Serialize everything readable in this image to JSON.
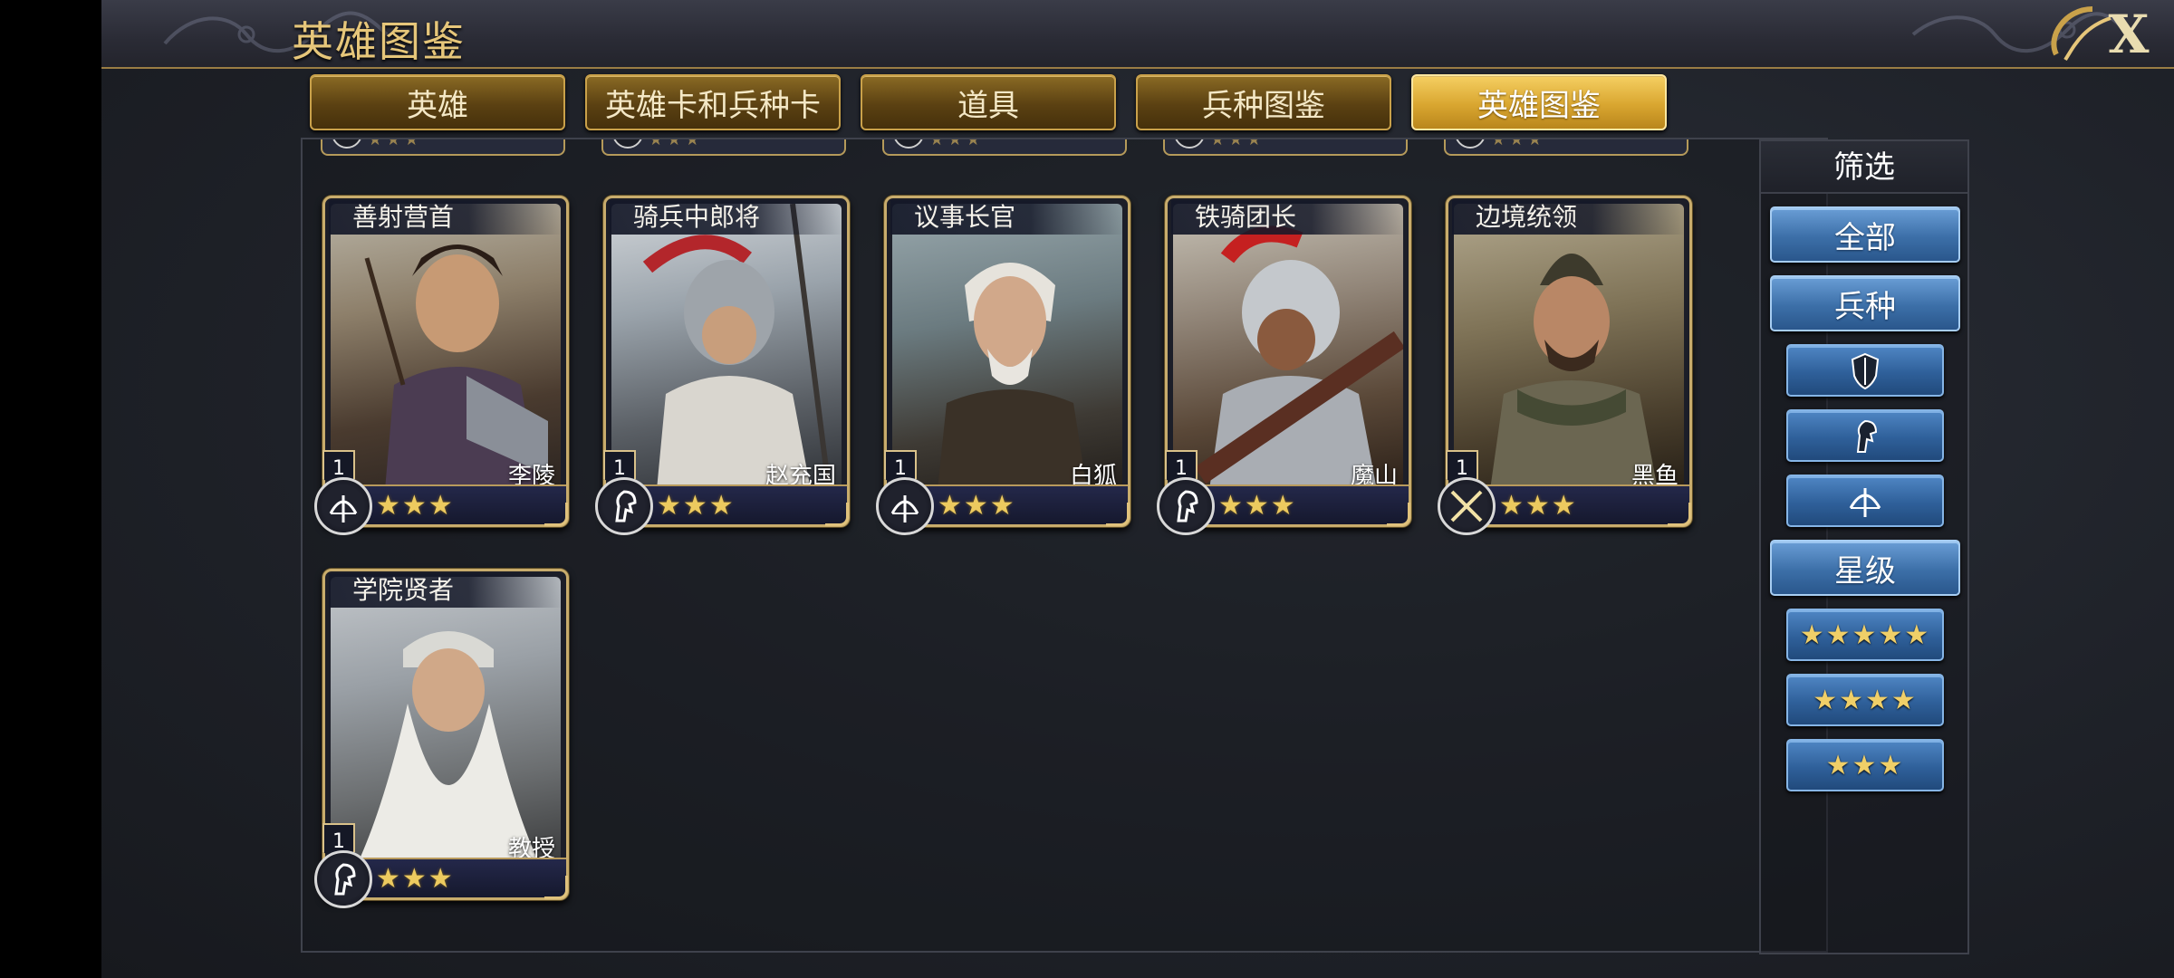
{
  "header": {
    "title": "英雄图鉴",
    "close_label": "X"
  },
  "tabs": [
    {
      "label": "英雄",
      "active": false
    },
    {
      "label": "英雄卡和兵种卡",
      "active": false
    },
    {
      "label": "道具",
      "active": false
    },
    {
      "label": "兵种图鉴",
      "active": false
    },
    {
      "label": "英雄图鉴",
      "active": true
    }
  ],
  "heroes": [
    {
      "title": "善射营首",
      "name": "李陵",
      "level": "1",
      "stars": "★★★",
      "troop": "archer-icon"
    },
    {
      "title": "骑兵中郎将",
      "name": "赵充国",
      "level": "1",
      "stars": "★★★",
      "troop": "cavalry-icon"
    },
    {
      "title": "议事长官",
      "name": "白狐",
      "level": "1",
      "stars": "★★★",
      "troop": "archer-icon"
    },
    {
      "title": "铁骑团长",
      "name": "魔山",
      "level": "1",
      "stars": "★★★",
      "troop": "cavalry-icon"
    },
    {
      "title": "边境统领",
      "name": "黑鱼",
      "level": "1",
      "stars": "★★★",
      "troop": "swords-icon"
    },
    {
      "title": "学院贤者",
      "name": "教授",
      "level": "1",
      "stars": "★★★",
      "troop": "cavalry-icon"
    }
  ],
  "filter": {
    "title": "筛选",
    "all_label": "全部",
    "troop_label": "兵种",
    "troop_filters": [
      "shield-icon",
      "cavalry-icon",
      "archer-icon"
    ],
    "star_label": "星级",
    "star_filters": [
      "★★★★★",
      "★★★★",
      "★★★"
    ]
  },
  "colors": {
    "gold": "#c8ac6c",
    "active_tab": "#e9b843",
    "filter_blue": "#3c6fa8"
  }
}
